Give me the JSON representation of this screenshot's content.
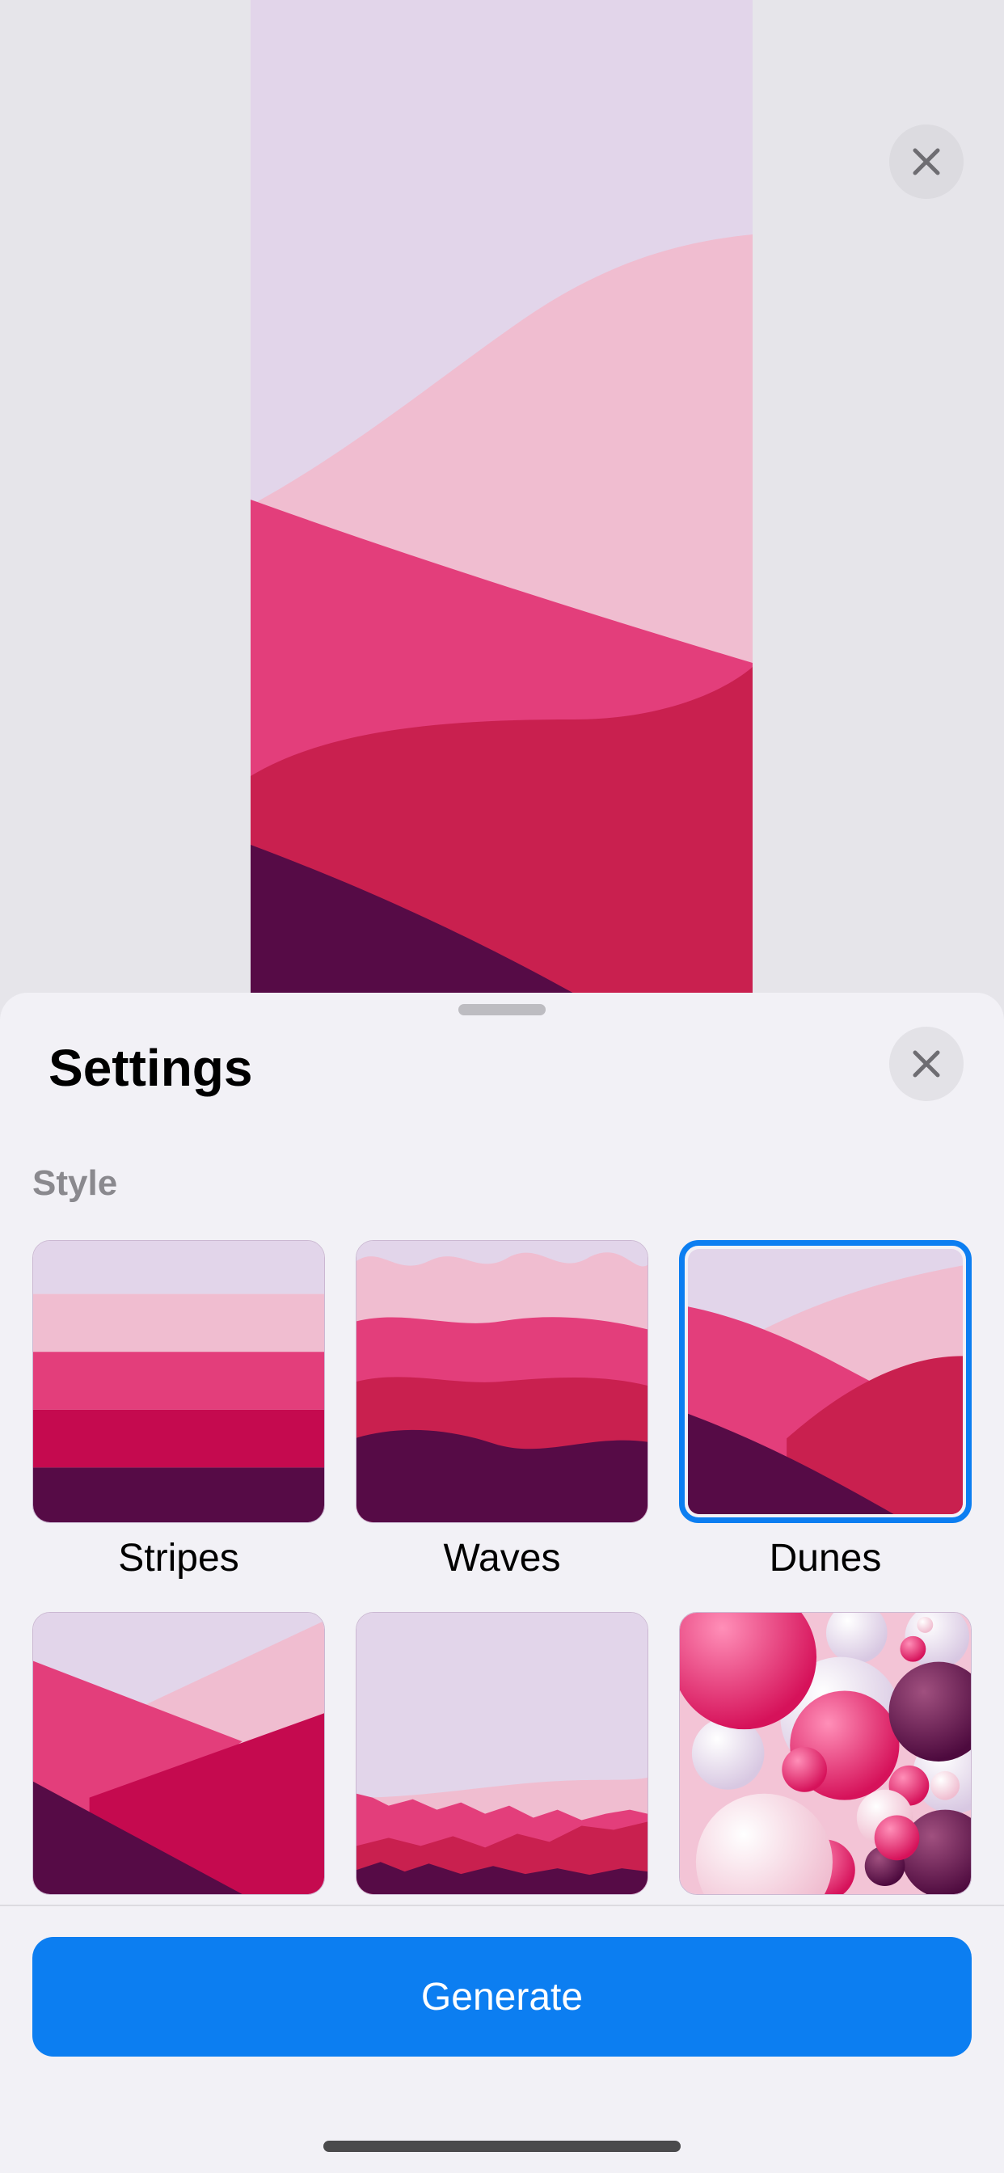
{
  "sheet": {
    "title": "Settings",
    "section_label": "Style",
    "styles": [
      {
        "label": "Stripes",
        "selected": false
      },
      {
        "label": "Waves",
        "selected": false
      },
      {
        "label": "Dunes",
        "selected": true
      },
      {
        "label": "",
        "selected": false
      },
      {
        "label": "",
        "selected": false
      },
      {
        "label": "",
        "selected": false
      }
    ],
    "generate_label": "Generate"
  },
  "icons": {
    "close": "close-icon"
  },
  "colors": {
    "accent": "#0c7ef1",
    "lavender": "#e2d5ea",
    "light_pink": "#f0bdd0",
    "pink": "#e33e7b",
    "crimson": "#c9204f",
    "magenta": "#c50a4f",
    "plum": "#560b46"
  }
}
